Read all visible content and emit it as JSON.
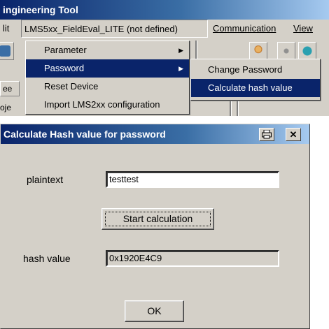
{
  "app": {
    "title": "ingineering Tool",
    "menu": {
      "item_partial": "lit",
      "device": "LMS5xx_FieldEval_LITE (not defined)",
      "communication": "Communication",
      "view": "View"
    },
    "strip_stubs": [
      "ee",
      "oje"
    ],
    "device_menu": {
      "items": [
        {
          "label": "Parameter",
          "has_submenu": true
        },
        {
          "label": "Password",
          "has_submenu": true,
          "selected": true
        },
        {
          "label": "Reset Device",
          "has_submenu": false
        },
        {
          "label": "Import LMS2xx configuration",
          "has_submenu": false
        }
      ]
    },
    "password_submenu": {
      "items": [
        {
          "label": "Change Password"
        },
        {
          "label": "Calculate hash value",
          "selected": true
        }
      ]
    }
  },
  "dialog": {
    "title": "Calculate Hash value for password",
    "plaintext_label": "plaintext",
    "plaintext_value": "testtest",
    "start_button": "Start calculation",
    "hash_label": "hash value",
    "hash_value": "0x1920E4C9",
    "ok_button": "OK"
  },
  "colors": {
    "title_blue": "#0a246a",
    "face": "#d4d0c8",
    "selection": "#0a246a"
  }
}
